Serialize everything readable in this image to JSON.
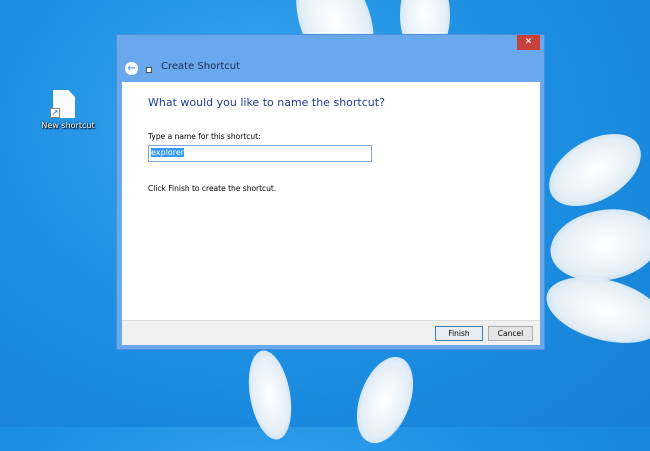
{
  "desktop": {
    "icon_label": "New shortcut"
  },
  "dialog": {
    "title": "Create Shortcut",
    "heading": "What would you like to name the shortcut?",
    "name_label": "Type a name for this shortcut:",
    "name_value": "explorer",
    "hint": "Click Finish to create the shortcut.",
    "finish_label": "Finish",
    "cancel_label": "Cancel",
    "close_glyph": "✕",
    "back_glyph": "←"
  }
}
